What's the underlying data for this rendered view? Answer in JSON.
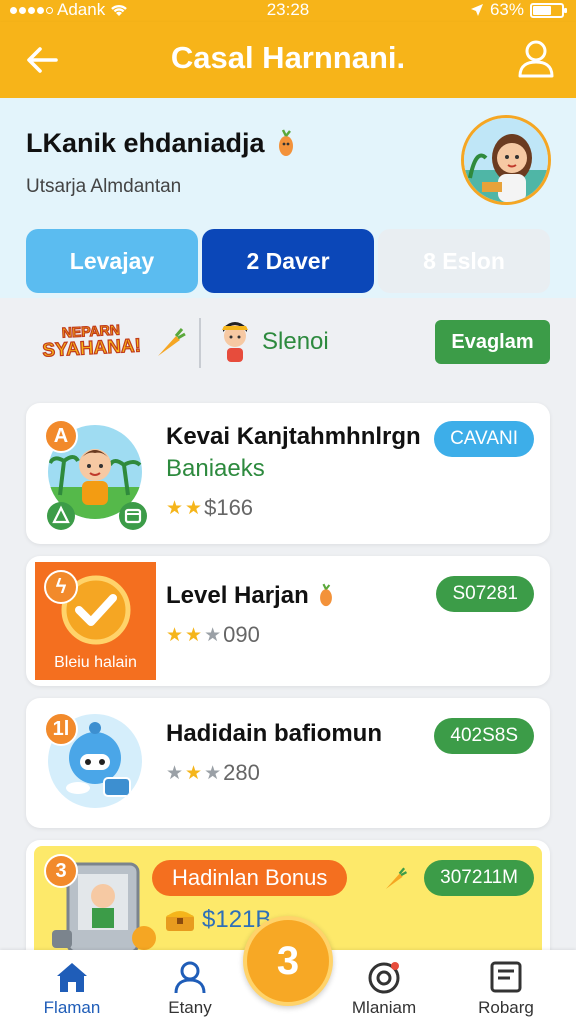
{
  "status": {
    "carrier": "Adank",
    "time": "23:28",
    "battery": "63%",
    "battery_level": 0.63
  },
  "header": {
    "title": "Casal Harnnani."
  },
  "profile": {
    "name": "LKanik ehdaniadja",
    "subtitle": "Utsarja Almdantan"
  },
  "tabs": [
    {
      "label": "Levajay"
    },
    {
      "label": "2 Daver"
    },
    {
      "label": "8 Eslon"
    }
  ],
  "strip": {
    "logo_line1": "NEPARN",
    "logo_line2": "SYAHANA!",
    "label": "Slenoi",
    "button": "Evaglam"
  },
  "cards": [
    {
      "badge": "A",
      "title": "Kevai Kanjtahmhnlrgn",
      "subtitle": "Baniaeks",
      "score": "$166",
      "pill": "CAVANI",
      "stars": 2
    },
    {
      "badge": "ϟ",
      "thumb_text": "Bleiu halain",
      "title": "Level Harjan",
      "score": "090",
      "pill": "S07281",
      "stars": 2
    },
    {
      "badge": "1l",
      "title": "Hadidain bafiomun",
      "score": "280",
      "pill": "402S8S",
      "stars": 2
    },
    {
      "badge": "3",
      "title": "Hadinlan Bonus",
      "amount": "$121B",
      "pill": "307211M"
    }
  ],
  "nav": [
    {
      "label": "Flaman"
    },
    {
      "label": "Etany"
    },
    {
      "label": "Mlaniam"
    },
    {
      "label": "Robarg"
    }
  ],
  "fab": {
    "label": "3"
  },
  "colors": {
    "brand": "#f7b419",
    "accent_blue": "#0b47b8",
    "success": "#3c9c48"
  }
}
